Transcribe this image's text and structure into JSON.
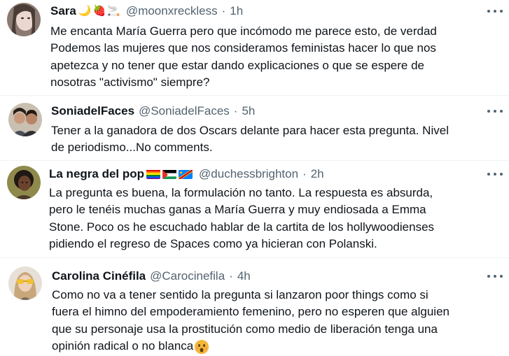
{
  "tweets": [
    {
      "name": "Sara",
      "emojis": [
        "🌙",
        "🍓",
        "🚬"
      ],
      "handle": "@moonxreckless",
      "time": "1h",
      "text": "Me encanta María Guerra pero que incómodo me parece esto, de verdad\nPodemos las mujeres que nos consideramos feministas hacer lo que nos\napetezca y no tener que estar dando explicaciones o que se espere de\nnosotras \"activismo\" siempre?"
    },
    {
      "name": "SoniadelFaces",
      "emojis": [],
      "handle": "@SoniadelFaces",
      "time": "5h",
      "text": "Tener a la ganadora de dos Oscars delante para hacer esta pregunta. Nivel\nde periodismo...No comments."
    },
    {
      "name": "La negra del pop",
      "emojis": [
        "rainbow-flag",
        "palestine-flag",
        "congo-flag"
      ],
      "handle": "@duchessbrighton",
      "time": "2h",
      "text": "La pregunta es buena, la formulación no tanto. La respuesta es absurda,\npero le tenéis muchas ganas a María Guerra y muy endiosada a Emma\nStone. Poco os he escuchado hablar de la cartita de los hollywoodienses\npidiendo el regreso de Spaces como ya hicieran con Polanski."
    },
    {
      "name": "Carolina Cinéfila",
      "emojis": [],
      "handle": "@Carocinefila",
      "time": "4h",
      "text": "Como no va a tener sentido la pregunta si lanzaron poor things como si\nfuera el himno del empoderamiento femenino, pero no esperen que alguien\nque su personaje usa la prostitución como medio de liberación tenga una\nopinión radical o no blanca"
    }
  ],
  "separator": "·",
  "colors": {
    "text": "#0f1419",
    "secondary": "#536471",
    "divider": "#eff3f4"
  }
}
